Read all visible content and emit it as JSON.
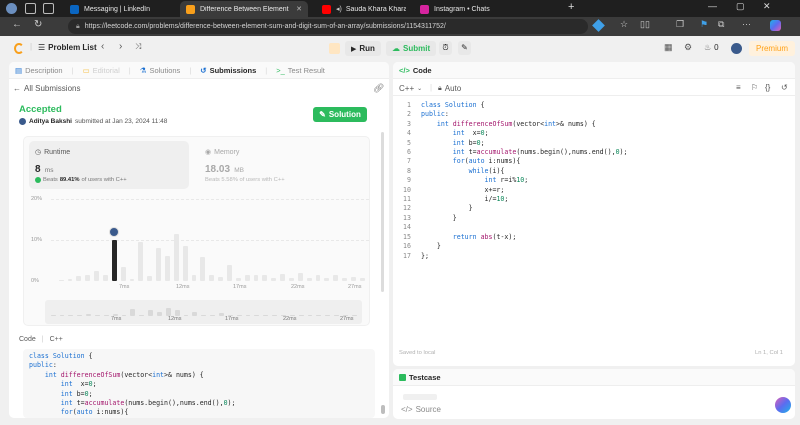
{
  "browser": {
    "tabs": [
      {
        "title": "Messaging | LinkedIn",
        "color": "#0a66c2"
      },
      {
        "title": "Difference Between Element Sum",
        "color": "#f89f1b",
        "active": true
      },
      {
        "title": "Sauda Khara Khara |Good N",
        "color": "#ff0000"
      },
      {
        "title": "Instagram • Chats",
        "color": "#d6249f"
      }
    ],
    "new_tab": "+",
    "url": "https://leetcode.com/problems/difference-between-element-sum-and-digit-sum-of-an-array/submissions/1154311752/"
  },
  "topnav": {
    "problem_list": "Problem List",
    "run": "Run",
    "submit": "Submit",
    "streak": "0",
    "premium": "Premium"
  },
  "left": {
    "tabs": [
      "Description",
      "Editorial",
      "Solutions",
      "Submissions",
      "Test Result"
    ],
    "back": "All Submissions",
    "status": "Accepted",
    "user": "Aditya Bakshi",
    "submitted": "submitted at Jan 23, 2024 11:48",
    "solution_btn": "Solution",
    "runtime": {
      "label": "Runtime",
      "value": "8",
      "unit": "ms",
      "beats_prefix": "Beats",
      "beats_pct": "89.41%",
      "beats_suffix": "of users with C++"
    },
    "memory": {
      "label": "Memory",
      "value": "18.03",
      "unit": "MB",
      "beats_text": "Beats 5.58% of users with C++"
    },
    "chart": {
      "y_ticks": [
        "20%",
        "10%",
        "0%"
      ],
      "x_ticks": [
        "7ms",
        "12ms",
        "17ms",
        "22ms",
        "27ms"
      ]
    },
    "code_header": "Code",
    "code_lang": "C++"
  },
  "chart_data": {
    "type": "bar",
    "title": "",
    "xlabel": "",
    "ylabel": "",
    "ylim": [
      0,
      20
    ],
    "x_ticks": [
      "7ms",
      "12ms",
      "17ms",
      "22ms",
      "27ms"
    ],
    "values": [
      0.3,
      0.6,
      1.2,
      1.5,
      2.5,
      1.5,
      1.0,
      3.5,
      0.5,
      9.5,
      1.3,
      8.0,
      6.0,
      11.5,
      8.5,
      1.5,
      5.8,
      1.5,
      1.0,
      4.0,
      0.8,
      1.5,
      1.5,
      1.5,
      0.8,
      1.8,
      0.8,
      2.0,
      0.8,
      1.5,
      0.8,
      1.5,
      0.8,
      1.0,
      0.8
    ],
    "highlight_index": 6,
    "highlight_value": 10.0
  },
  "right": {
    "header": "Code",
    "lang": "C++",
    "autocomplete": "Auto",
    "saved": "Saved to local",
    "cursor": "Ln 1, Col 1",
    "testcase": "Testcase",
    "source": "Source"
  },
  "code_lines": [
    "class Solution {",
    "public:",
    "    int differenceOfSum(vector<int>& nums) {",
    "        int  x=0;",
    "        int b=0;",
    "        int t=accumulate(nums.begin(),nums.end(),0);",
    "        for(auto i:nums){",
    "            while(i){",
    "                int r=i%10;",
    "                x+=r;",
    "                i/=10;",
    "            }",
    "        }",
    "",
    "        return abs(t-x);",
    "    }",
    "};"
  ],
  "colors": {
    "accepted": "#2cbb5d",
    "run_green": "#2cbb5d",
    "premium": "#ffa116",
    "beats_icon": "#2cbb5d"
  }
}
